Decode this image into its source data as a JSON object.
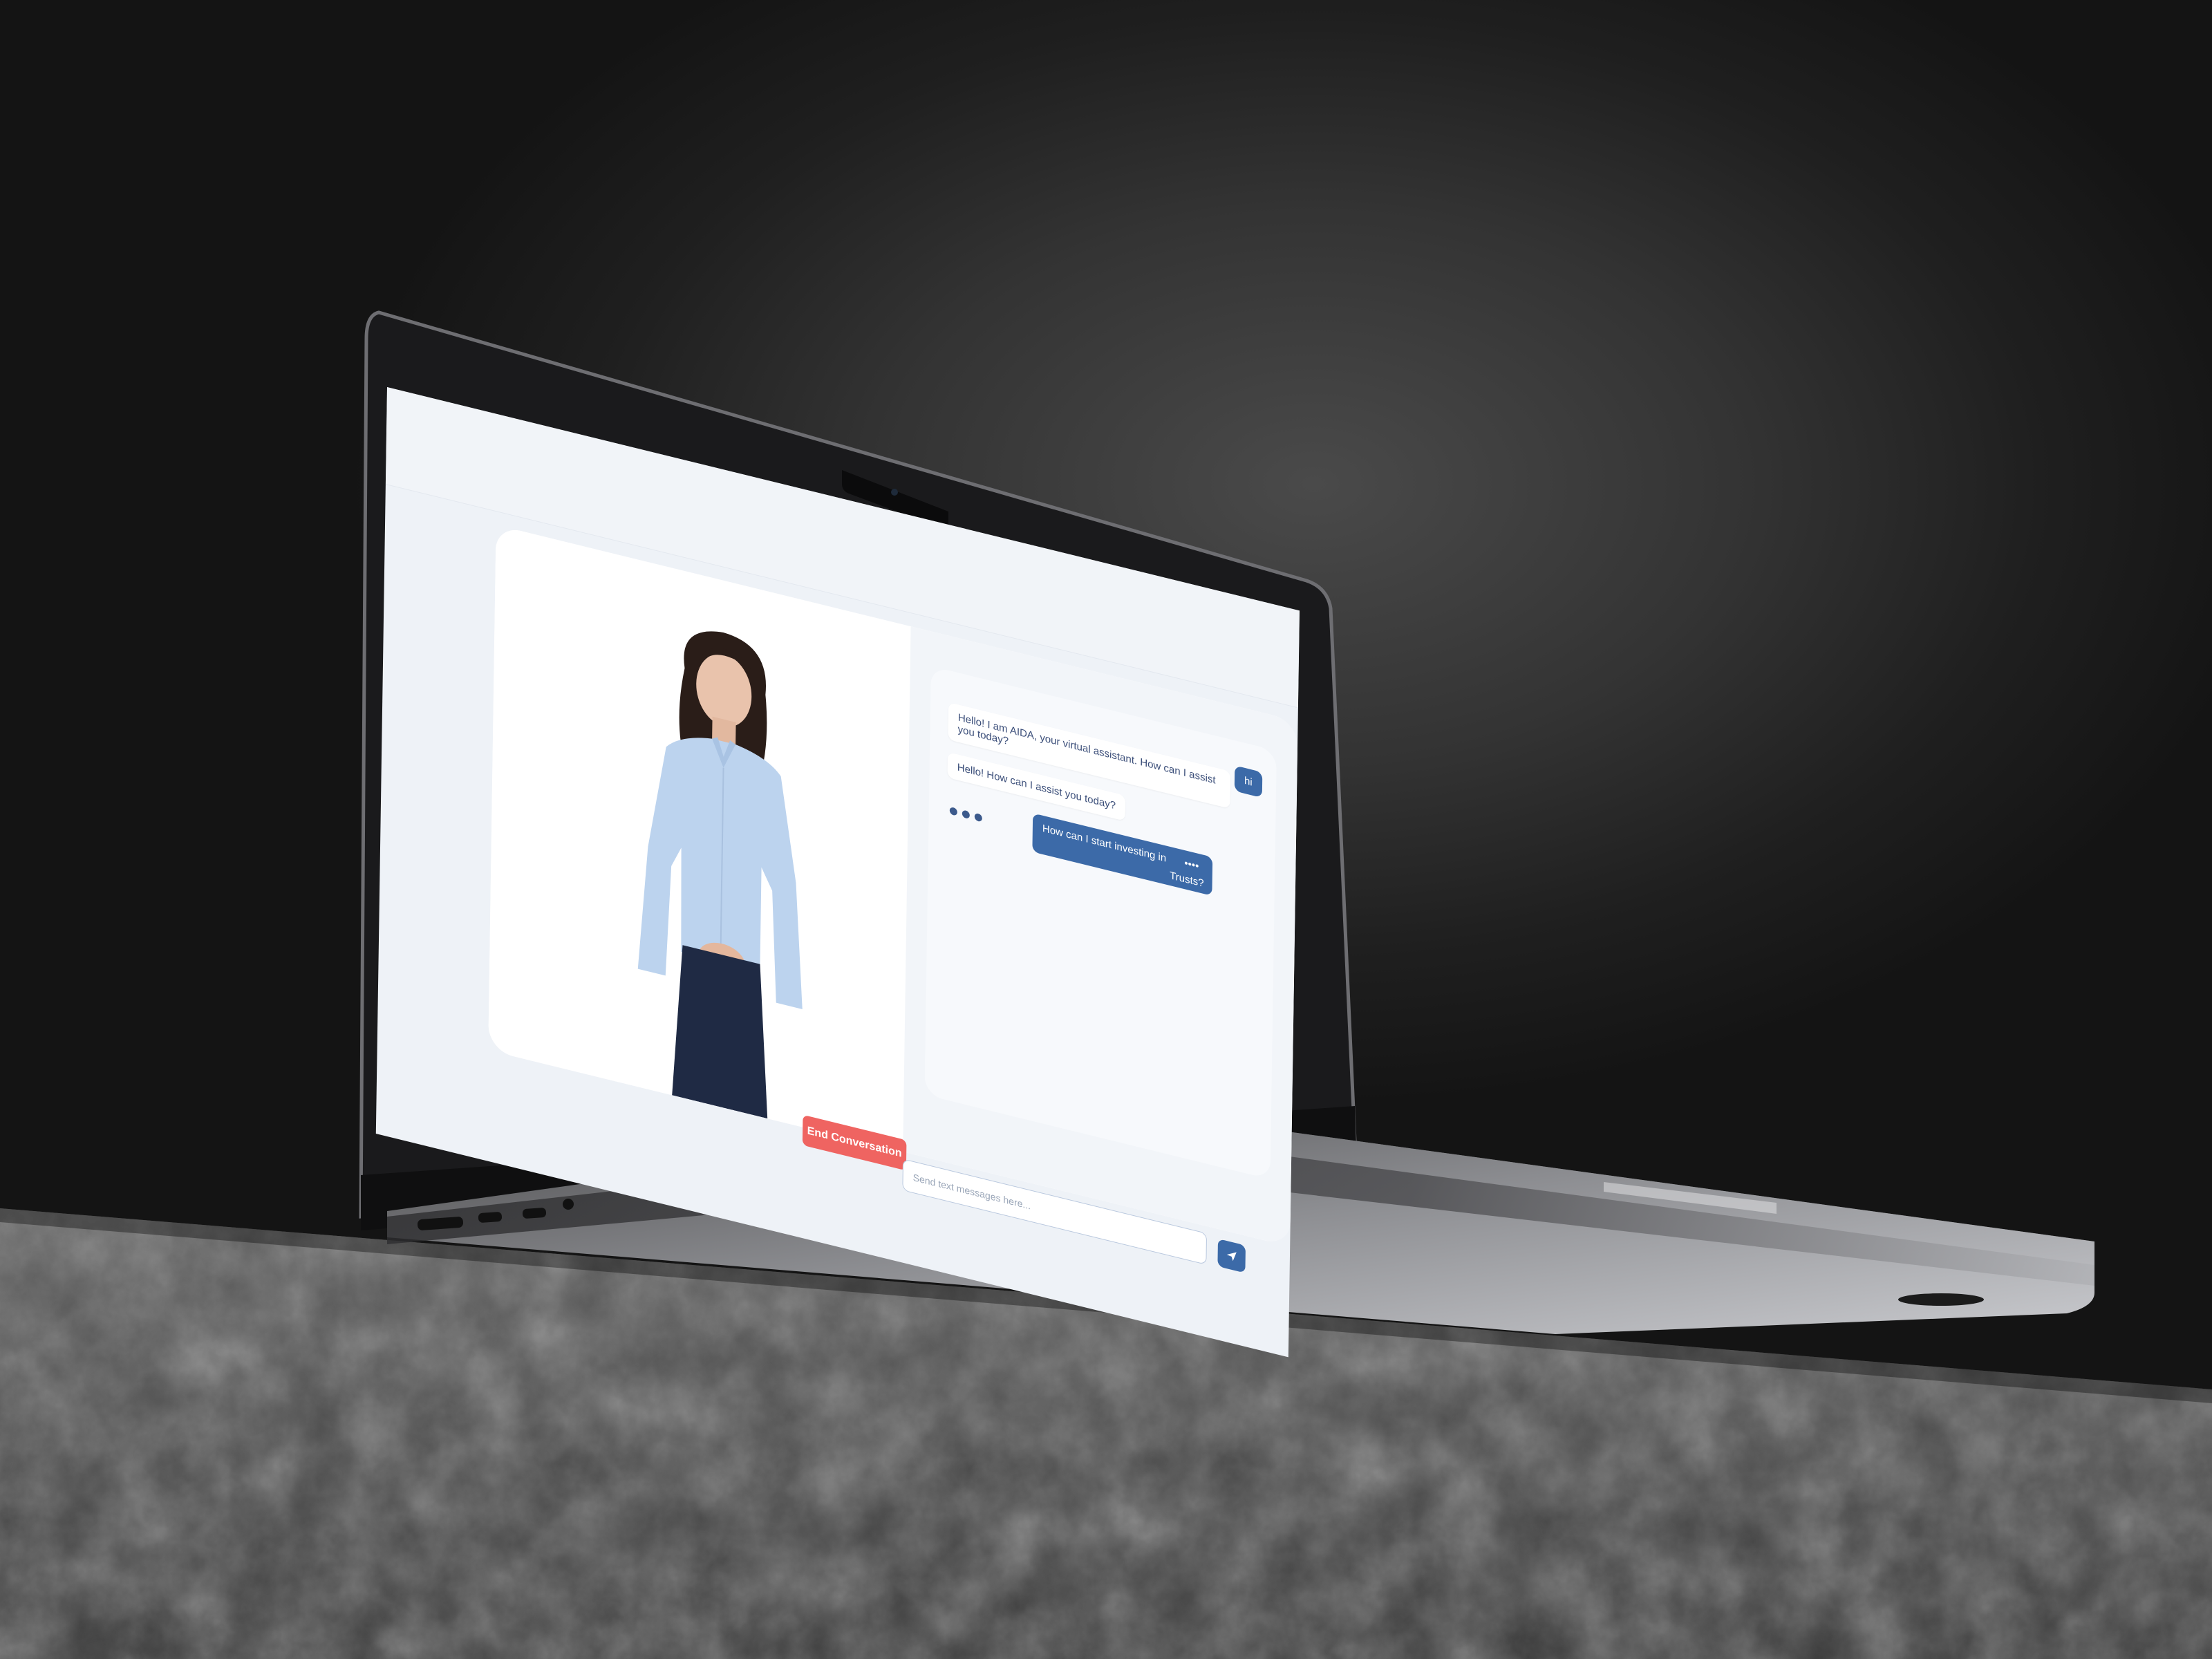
{
  "app": {
    "assistant_name": "AIDA"
  },
  "conversation": {
    "messages": [
      {
        "role": "user",
        "text": "hi"
      },
      {
        "role": "assistant",
        "text": "Hello! I am AIDA, your virtual assistant. How can I assist you today?"
      },
      {
        "role": "assistant",
        "text": "Hello! How can I assist you today?"
      },
      {
        "role": "user",
        "text": "How can I start investing in",
        "masked": "••••",
        "tail": "Trusts?"
      }
    ],
    "typing_indicator": true
  },
  "controls": {
    "end_label": "End Conversation",
    "input_placeholder": "Send text messages here...",
    "send_icon": "send-icon"
  },
  "colors": {
    "accent": "#3c6aa8",
    "danger": "#ef6461",
    "chat_bg": "#f2f5f9",
    "bot_text": "#3c4f7a"
  }
}
